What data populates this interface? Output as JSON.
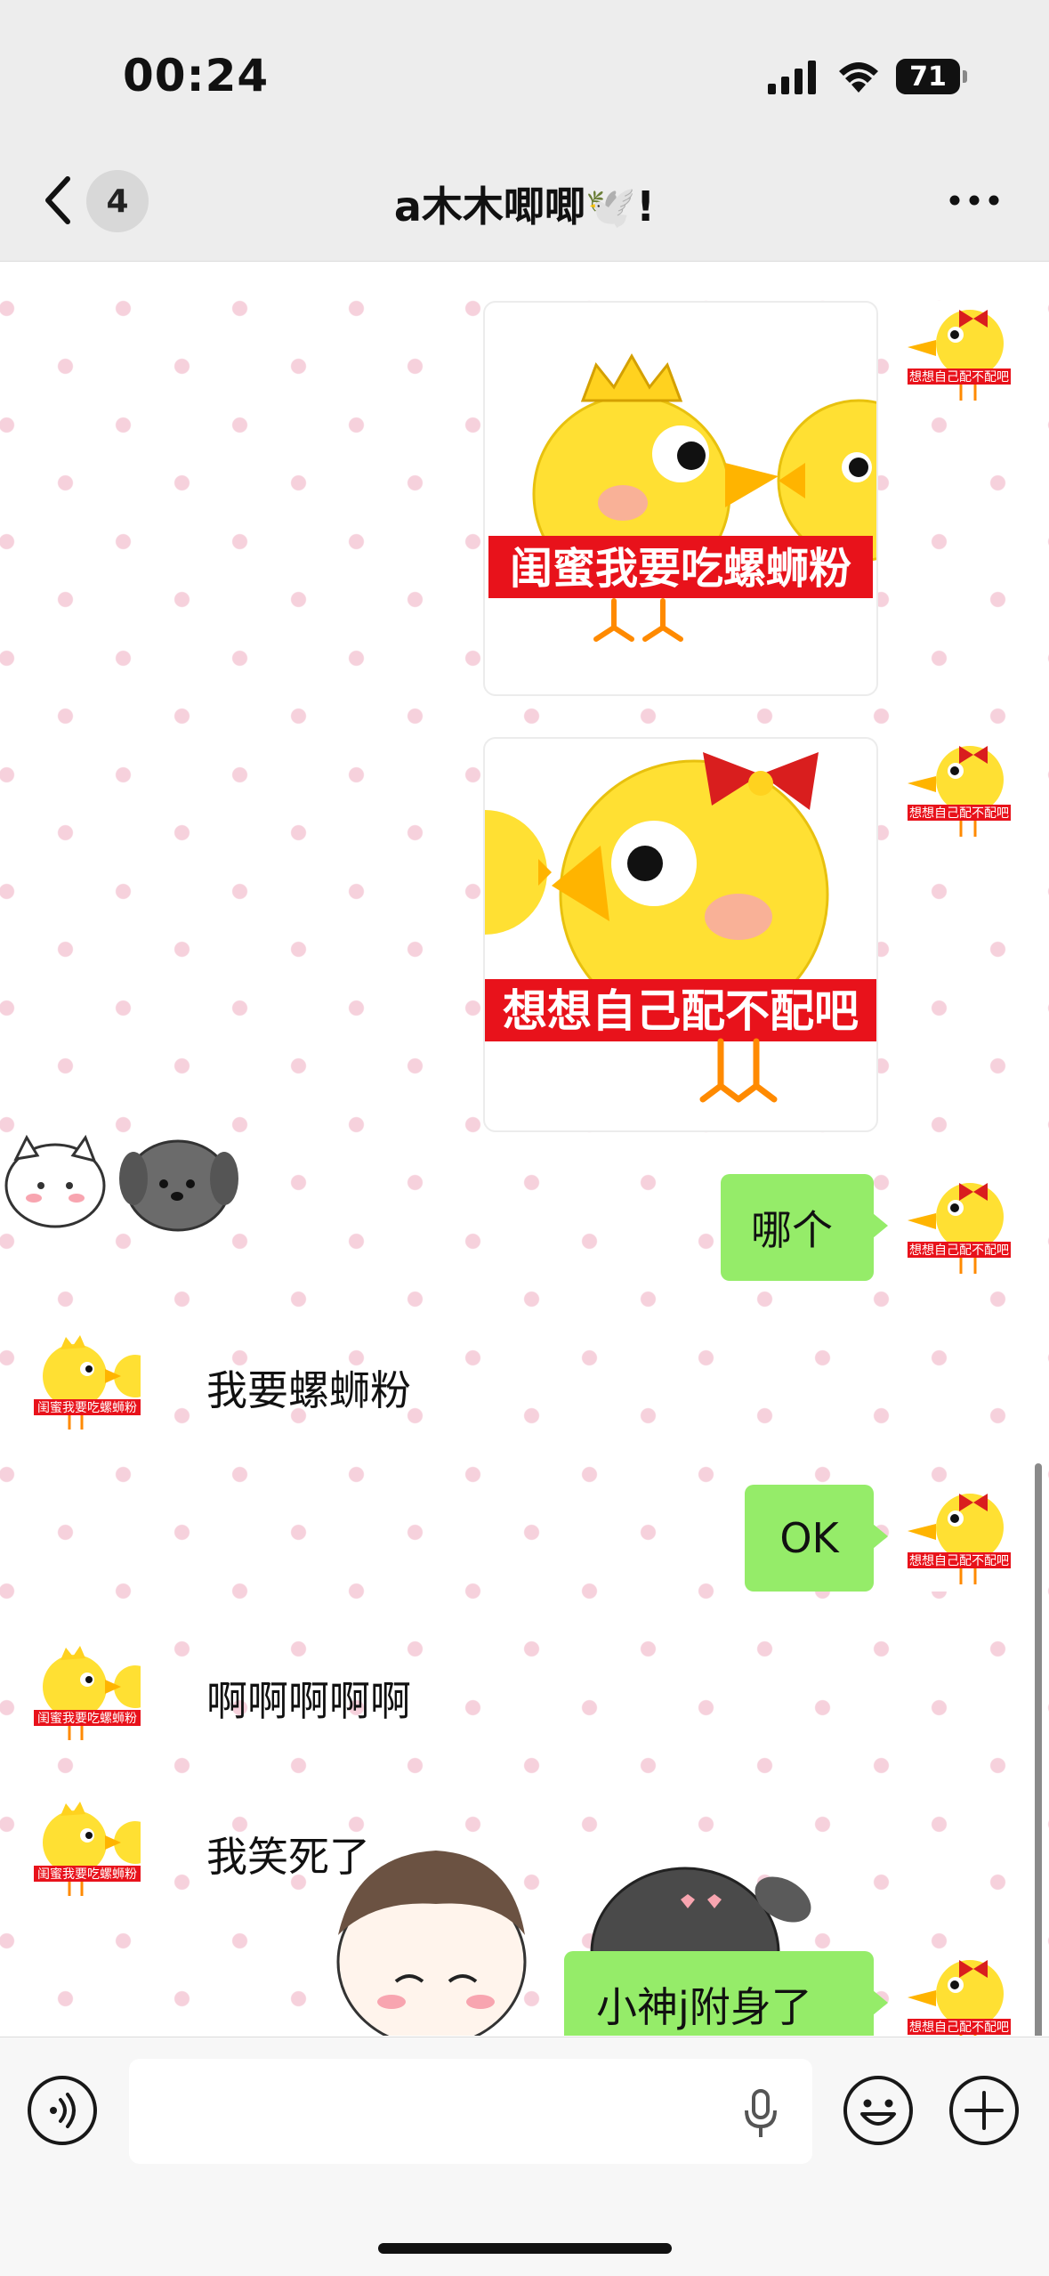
{
  "status_bar": {
    "time": "00:24",
    "battery": "71"
  },
  "header": {
    "unread_count": "4",
    "title": "a木木唧唧🕊️!"
  },
  "stickers": {
    "chick_crown_caption": "闺蜜我要吃螺蛳粉",
    "chick_bow_caption": "想想自己配不配吧"
  },
  "avatars": {
    "self_caption": "想想自己配不配吧",
    "friend_caption": "闺蜜我要吃螺蛳粉"
  },
  "messages": {
    "m3": "哪个",
    "m4": "我要螺蛳粉",
    "m5": "OK",
    "m6": "啊啊啊啊啊",
    "m7": "我笑死了",
    "m8": "小神j附身了"
  },
  "colors": {
    "outgoing_bubble": "#95ec69",
    "header_bg": "#ededed",
    "wallpaper_dot": "#f6d1dc",
    "caption_red": "#e8121b"
  },
  "icons": [
    "chevron-left-icon",
    "more-dots-icon",
    "signal-icon",
    "wifi-icon",
    "battery-icon",
    "voice-icon",
    "mic-icon",
    "emoji-icon",
    "plus-icon"
  ]
}
